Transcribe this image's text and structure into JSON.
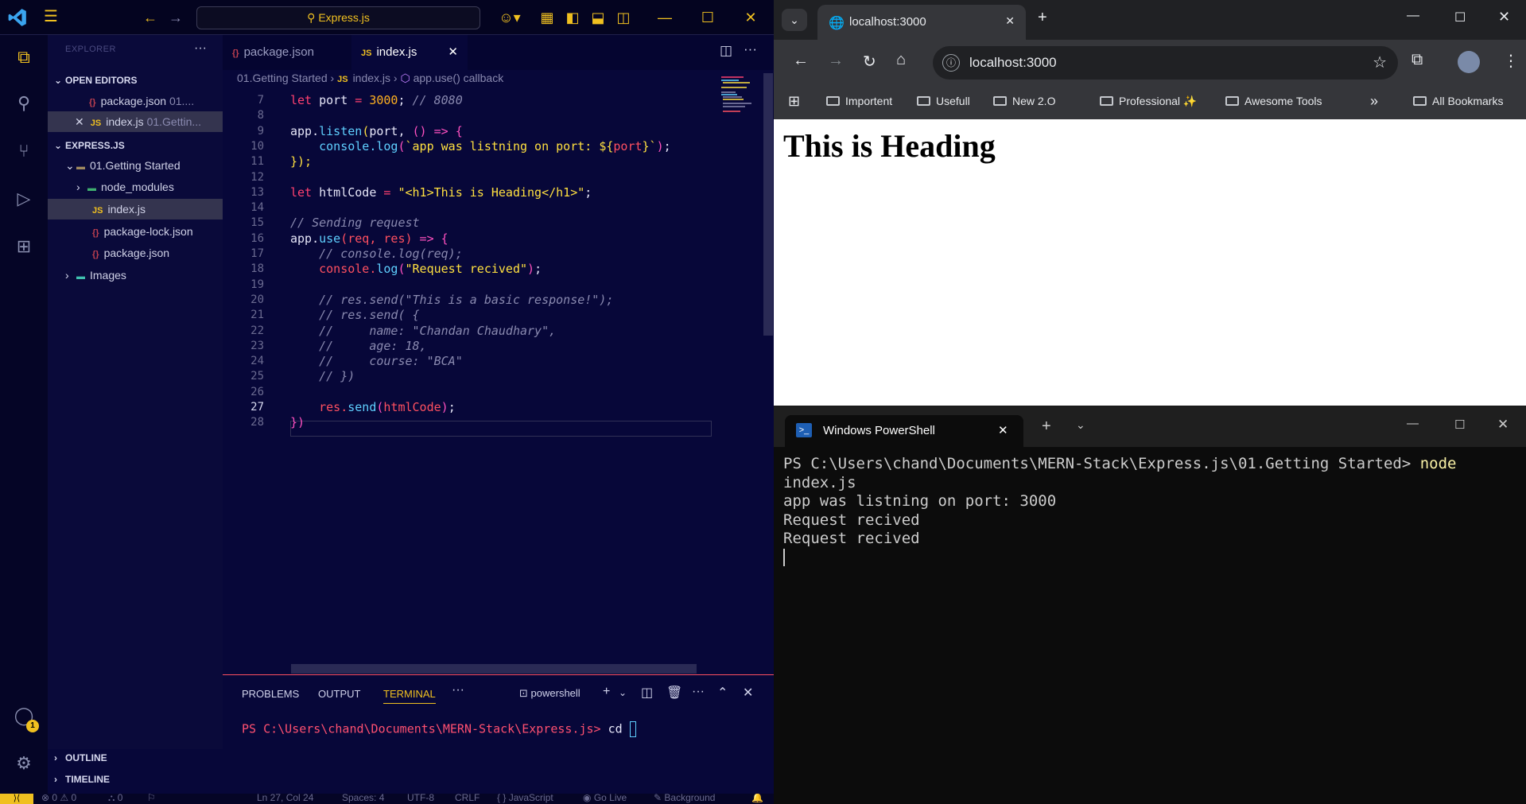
{
  "vscode": {
    "search_text": "Express.js",
    "sidebar": {
      "header": "EXPLORER",
      "open_editors_label": "OPEN EDITORS",
      "open_editors": [
        {
          "name": "package.json",
          "path": "01...."
        },
        {
          "name": "index.js",
          "path": "01.Gettin..."
        }
      ],
      "project_label": "EXPRESS.JS",
      "tree": [
        {
          "name": "01.Getting Started"
        },
        {
          "name": "node_modules"
        },
        {
          "name": "index.js"
        },
        {
          "name": "package-lock.json"
        },
        {
          "name": "package.json"
        },
        {
          "name": "Images"
        }
      ],
      "outline_label": "OUTLINE",
      "timeline_label": "TIMELINE"
    },
    "tabs": [
      {
        "label": "package.json"
      },
      {
        "label": "index.js"
      }
    ],
    "breadcrumb": {
      "folder": "01.Getting Started",
      "file": "index.js",
      "symbol": "app.use() callback"
    },
    "line_numbers": [
      "7",
      "8",
      "9",
      "10",
      "11",
      "12",
      "13",
      "14",
      "15",
      "16",
      "17",
      "18",
      "19",
      "20",
      "21",
      "22",
      "23",
      "24",
      "25",
      "26",
      "27",
      "28"
    ],
    "code": {
      "l7_port": "port",
      "l7_value": "3000",
      "l7_comment": "// 8080",
      "l9_a": "app.",
      "l9_fn": "listen",
      "l9_b": "port, ",
      "l9_c": "() => {",
      "l10_a": "console.",
      "l10_fn": "log",
      "l10_str": "`app was listning on port: ${",
      "l10_var": "port",
      "l10_end": "}`",
      "l11": "});",
      "l13_var": "htmlCode",
      "l13_str": "\"<h1>This is Heading</h1>\"",
      "l15": "// Sending request",
      "l16_a": "app.",
      "l16_fn": "use",
      "l16_params": "(req, res)",
      "l16_arrow": " => {",
      "l17": "// console.log(req);",
      "l18_a": "console.",
      "l18_fn": "log",
      "l18_str": "\"Request recived\"",
      "l20": "// res.send(\"This is a basic response!\");",
      "l21": "// res.send( {",
      "l22": "//     name: \"Chandan Chaudhary\",",
      "l23": "//     age: 18,",
      "l24": "//     course: \"BCA\"",
      "l25": "// })",
      "l27_a": "res.",
      "l27_fn": "send",
      "l27_arg": "htmlCode",
      "l28": "})",
      "kw_let": "let"
    },
    "panel": {
      "tabs": [
        "PROBLEMS",
        "OUTPUT",
        "TERMINAL"
      ],
      "shell": "powershell",
      "prompt": "PS C:\\Users\\chand\\Documents\\MERN-Stack\\Express.js>",
      "command": "cd"
    },
    "statusbar": {
      "errors": "0",
      "warnings": "0",
      "ports": "0",
      "position": "Ln 27, Col 24",
      "spaces": "Spaces: 4",
      "encoding": "UTF-8",
      "eol": "CRLF",
      "language": "JavaScript",
      "golive": "Go Live",
      "background": "Background"
    },
    "badge": "1",
    "accent": "#f0c020"
  },
  "chrome": {
    "tab_title": "localhost:3000",
    "url": "localhost:3000",
    "bookmarks": [
      "Importent",
      "Usefull",
      "New 2.O",
      "Professional ✨",
      "Awesome Tools"
    ],
    "all_bookmarks": "All Bookmarks",
    "page_heading": "This is Heading"
  },
  "powershell": {
    "tab_title": "Windows PowerShell",
    "lines": [
      "PS C:\\Users\\chand\\Documents\\MERN-Stack\\Express.js\\01.Getting Started> ",
      "index.js",
      "app was listning on port: 3000",
      "Request recived",
      "Request recived"
    ],
    "cmd": "node"
  }
}
